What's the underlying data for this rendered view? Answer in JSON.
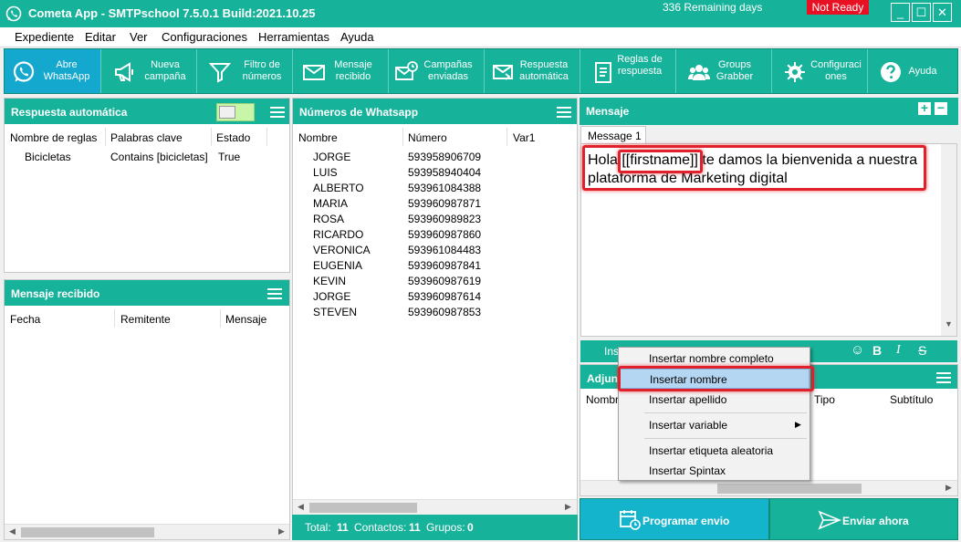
{
  "titlebar": {
    "title": "Cometa App - SMTPschool 7.5.0.1 Build:2021.10.25",
    "remaining": "336 Remaining days",
    "status": "Not Ready",
    "minimize": "_",
    "maximize": "☐",
    "close": "✕"
  },
  "menu": [
    "Expediente",
    "Editar",
    "Ver",
    "Configuraciones",
    "Herramientas",
    "Ayuda"
  ],
  "toolbar": [
    {
      "label": "Abre\nWhatsApp",
      "icon": "whatsapp-icon"
    },
    {
      "label": "Nueva\ncampaña",
      "icon": "megaphone-icon"
    },
    {
      "label": "Filtro de\nnúmeros",
      "icon": "funnel-icon"
    },
    {
      "label": "Mensaje\nrecibido",
      "icon": "inbox-envelope-icon"
    },
    {
      "label": "Campañas\nenviadas",
      "icon": "clock-envelope-icon"
    },
    {
      "label": "Respuesta\nautomática",
      "icon": "reply-envelope-icon"
    },
    {
      "label": "Reglas de\nrespuesta",
      "icon": "rules-document-icon"
    },
    {
      "label": "Groups\nGrabber",
      "icon": "group-icon"
    },
    {
      "label": "Configuraci\nones",
      "icon": "gear-icon"
    },
    {
      "label": "Ayuda",
      "icon": "help-icon"
    }
  ],
  "auto_reply": {
    "title": "Respuesta automática",
    "columns": [
      "Nombre de reglas",
      "Palabras clave",
      "Estado"
    ],
    "rows": [
      [
        "Bicicletas",
        "Contains [bicicletas]",
        "True"
      ]
    ]
  },
  "received": {
    "title": "Mensaje recibido",
    "columns": [
      "Fecha",
      "Remitente",
      "Mensaje"
    ]
  },
  "numbers": {
    "title": "Números de Whatsapp",
    "columns": [
      "Nombre",
      "Número",
      "Var1"
    ],
    "rows": [
      [
        "JORGE",
        "593958906709"
      ],
      [
        "LUIS",
        "593958940404"
      ],
      [
        "ALBERTO",
        "593961084388"
      ],
      [
        "MARIA",
        "593960987871"
      ],
      [
        "ROSA",
        "593960989823"
      ],
      [
        "RICARDO",
        "593960987860"
      ],
      [
        "VERONICA",
        "593961084483"
      ],
      [
        "EUGENIA",
        "593960987841"
      ],
      [
        "KEVIN",
        "593960987619"
      ],
      [
        "JORGE",
        "593960987614"
      ],
      [
        "STEVEN",
        "593960987853"
      ]
    ],
    "status": {
      "total_label": "Total:",
      "total": "11",
      "contacts_label": "Contactos:",
      "contacts": "11",
      "groups_label": "Grupos:",
      "groups": "0"
    }
  },
  "message": {
    "title": "Mensaje",
    "tab": "Message 1",
    "text_prefix": "Hola ",
    "placeholder_token": "[[firstname]]",
    "text_rest": " te damos la bienvenida a nuestra plataforma de Marketing digital",
    "insert_label_partial": "Ins"
  },
  "attachments": {
    "title_partial": "Adjun",
    "columns": [
      "Nombre",
      "Tipo",
      "Subtítulo"
    ]
  },
  "context_menu": [
    "Insertar nombre completo",
    "Insertar nombre",
    "Insertar apellido",
    "Insertar variable",
    "Insertar etiqueta aleatoria",
    "Insertar Spintax"
  ],
  "buttons": {
    "schedule": "Programar envio",
    "send_now": "Enviar ahora"
  },
  "colors": {
    "accent": "#17b29a",
    "active": "#14a8cf",
    "highlight": "#e0202a"
  }
}
